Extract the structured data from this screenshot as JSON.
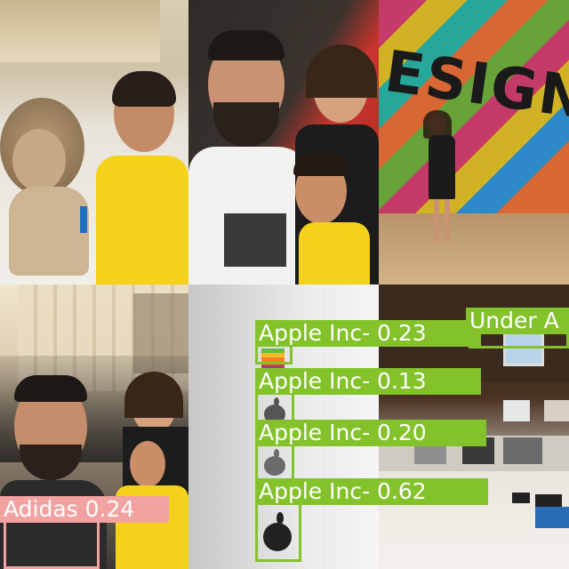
{
  "detections": [
    {
      "label": "Apple Inc- 0.23",
      "class": "Apple Inc-",
      "score": 0.23,
      "color": "#83c22a"
    },
    {
      "label": "Apple Inc- 0.13",
      "class": "Apple Inc-",
      "score": 0.13,
      "color": "#83c22a"
    },
    {
      "label": "Apple Inc- 0.20",
      "class": "Apple Inc-",
      "score": 0.2,
      "color": "#83c22a"
    },
    {
      "label": "Apple Inc- 0.62",
      "class": "Apple Inc-",
      "score": 0.62,
      "color": "#83c22a"
    },
    {
      "label": "Under A",
      "class": "Under Armour",
      "score": null,
      "color": "#83c22a"
    },
    {
      "label": "Adidas 0.24",
      "class": "Adidas",
      "score": 0.24,
      "color": "#f2a2a0"
    }
  ],
  "wall_text": "ESIGNER"
}
